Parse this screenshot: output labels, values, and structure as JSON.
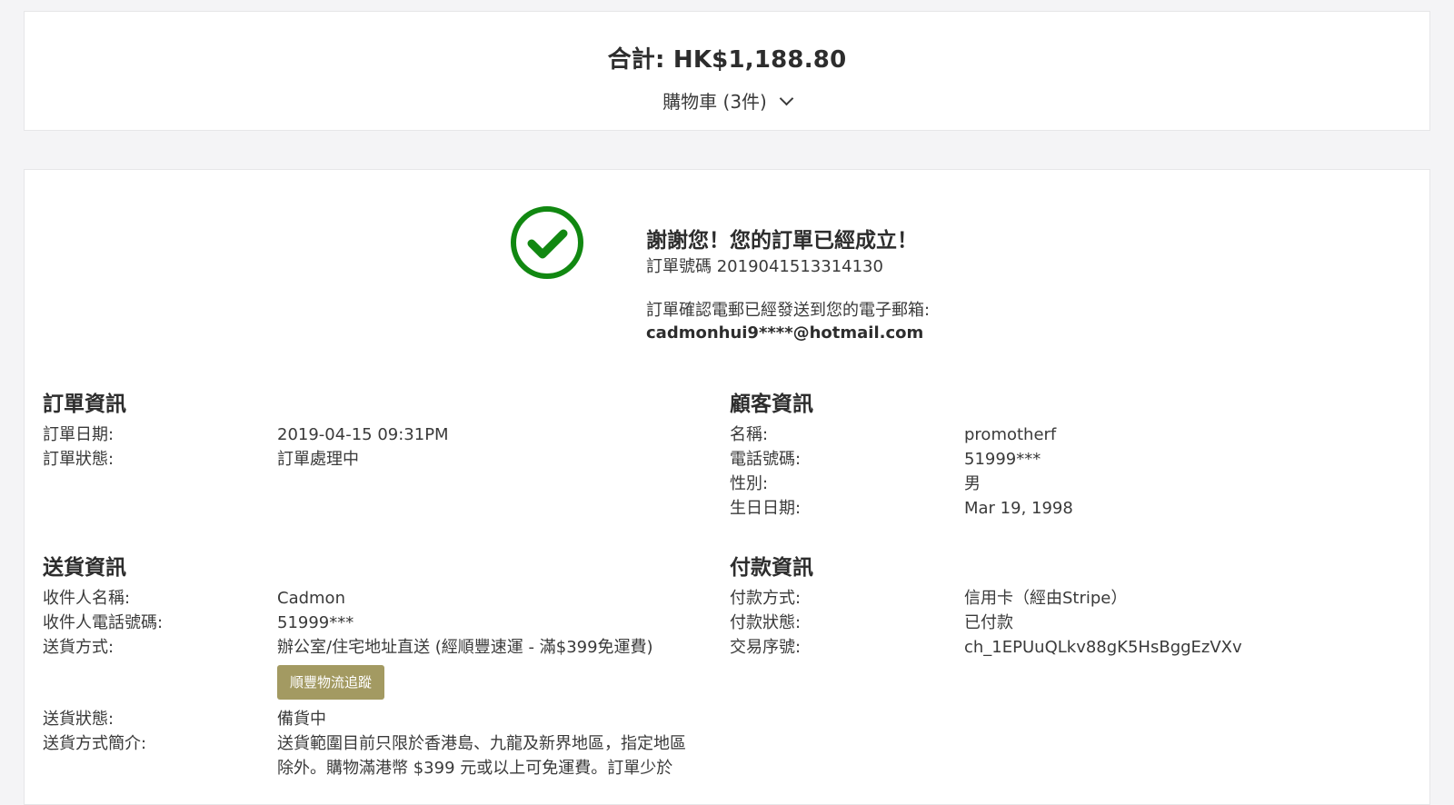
{
  "summary": {
    "total_label": "合計:",
    "total_amount": "HK$1,188.80",
    "cart_label": "購物車 (3件)"
  },
  "confirmation": {
    "title": "謝謝您！您的訂單已經成立！",
    "order_number": "訂單號碼 2019041513314130",
    "email_note": "訂單確認電郵已經發送到您的電子郵箱:",
    "email": "cadmonhui9****@hotmail.com"
  },
  "order_info": {
    "title": "訂單資訊",
    "rows": [
      {
        "label": "訂單日期:",
        "value": "2019-04-15 09:31PM"
      },
      {
        "label": "訂單狀態:",
        "value": "訂單處理中"
      }
    ]
  },
  "customer_info": {
    "title": "顧客資訊",
    "rows": [
      {
        "label": "名稱:",
        "value": "promotherf"
      },
      {
        "label": "電話號碼:",
        "value": "51999***"
      },
      {
        "label": "性別:",
        "value": "男"
      },
      {
        "label": "生日日期:",
        "value": "Mar 19, 1998"
      }
    ]
  },
  "delivery_info": {
    "title": "送貨資訊",
    "rows": [
      {
        "label": "收件人名稱:",
        "value": "Cadmon"
      },
      {
        "label": "收件人電話號碼:",
        "value": "51999***"
      },
      {
        "label": "送貨方式:",
        "value": "辦公室/住宅地址直送 (經順豐速運 - 滿$399免運費)"
      }
    ],
    "track_button": "順豐物流追蹤",
    "status_label": "送貨狀態:",
    "status_value": "備貨中",
    "desc_label": "送貨方式簡介:",
    "desc_value": "送貨範圍目前只限於香港島、九龍及新界地區，指定地區除外。購物滿港幣 $399 元或以上可免運費。訂單少於"
  },
  "payment_info": {
    "title": "付款資訊",
    "rows": [
      {
        "label": "付款方式:",
        "value": "信用卡（經由Stripe）"
      },
      {
        "label": "付款狀態:",
        "value": "已付款"
      },
      {
        "label": "交易序號:",
        "value": "ch_1EPUuQLkv88gK5HsBggEzVXv"
      }
    ]
  },
  "colors": {
    "success_green": "#118811",
    "track_button_bg": "#a39a62"
  },
  "icons": {
    "check": "check-circle-icon",
    "chevron": "chevron-down-icon"
  }
}
